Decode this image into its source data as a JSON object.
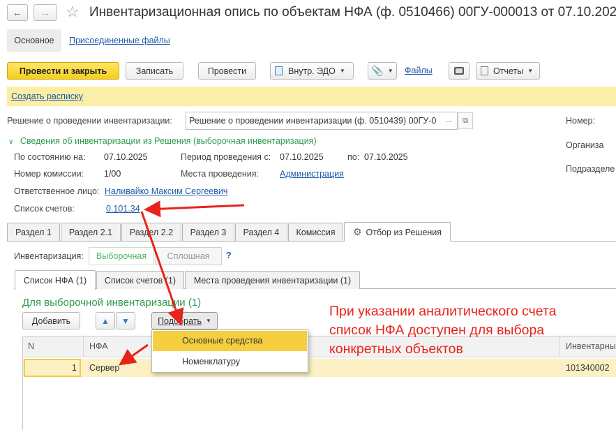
{
  "window": {
    "title": "Инвентаризационная опись по объектам НФА (ф. 0510466) 00ГУ-000013 от 07.10.202"
  },
  "nav_tabs": {
    "main": "Основное",
    "files": "Присоединенные файлы"
  },
  "toolbar": {
    "post_close": "Провести и закрыть",
    "save": "Записать",
    "post": "Провести",
    "edo": "Внутр. ЭДО",
    "files": "Файлы",
    "reports": "Отчеты"
  },
  "notice": {
    "link": "Создать расписку"
  },
  "decision": {
    "label": "Решение о проведении инвентаризации:",
    "value": "Решение о проведении инвентаризации (ф. 0510439) 00ГУ-0",
    "more": "..."
  },
  "right_labels": {
    "number": "Номер:",
    "org": "Организа",
    "dept": "Подразделе"
  },
  "info_section": {
    "title": "Сведения об инвентаризации из Решения (выборочная инвентаризация)",
    "as_of_label": "По состоянию на:",
    "as_of_value": "07.10.2025",
    "period_label": "Период проведения с:",
    "period_from": "07.10.2025",
    "period_to_label": "по:",
    "period_to": "07.10.2025",
    "commission_label": "Номер комиссии:",
    "commission_value": "1/00",
    "places_label": "Места проведения:",
    "places_value": "Администрация",
    "responsible_label": "Ответственное лицо:",
    "responsible_value": "Наливайко Максим Сергеевич",
    "accounts_label": "Список счетов:",
    "accounts_value": "0.101.34"
  },
  "section_tabs": [
    "Раздел 1",
    "Раздел 2.1",
    "Раздел 2.2",
    "Раздел 3",
    "Раздел 4",
    "Комиссия",
    "Отбор из Решения"
  ],
  "inventory_type": {
    "label": "Инвентаризация:",
    "selective": "Выборочная",
    "full": "Сплошная",
    "help": "?"
  },
  "sub_tabs": [
    "Список НФА (1)",
    "Список счетов (1)",
    "Места проведения инвентаризации (1)"
  ],
  "list": {
    "title": "Для выборочной инвентаризации (1)",
    "add": "Добавить",
    "pick": "Подобрать",
    "columns": {
      "n": "N",
      "nfa": "НФА",
      "inv": "Инвентарны"
    },
    "rows": [
      {
        "n": "1",
        "nfa": "Сервер",
        "inv": "101340002"
      }
    ]
  },
  "dropdown": {
    "items": [
      "Основные средства",
      "Номенклатуру"
    ]
  },
  "annotation": {
    "line1": "При указании аналитического счета",
    "line2": "список НФА доступен для выбора",
    "line3": "конкретных объектов"
  },
  "colors": {
    "accent_yellow": "#f5cf1e",
    "notice_bg": "#fbeea6",
    "link_blue": "#1f5aa8",
    "section_green": "#2e9b4e",
    "annotation_red": "#e8231b",
    "selected_row": "#fbf1c4"
  }
}
